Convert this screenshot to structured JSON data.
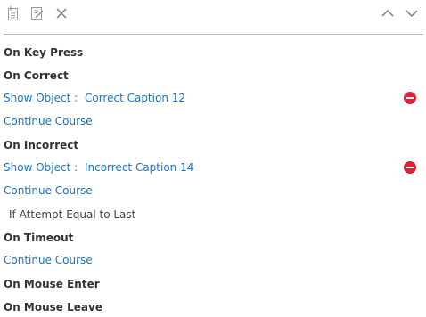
{
  "toolbar": {
    "icons": [
      "new-action-icon",
      "edit-action-icon",
      "close-icon",
      "chevron-up-icon",
      "chevron-down-icon"
    ]
  },
  "events": {
    "on_key_press": "On Key Press",
    "on_correct": "On Correct",
    "correct_show_label": "Show Object :",
    "correct_show_target": "Correct Caption 12",
    "correct_continue": "Continue Course",
    "on_incorrect": "On Incorrect",
    "incorrect_show_label": "Show Object :",
    "incorrect_show_target": "Incorrect Caption 14",
    "incorrect_continue": "Continue Course",
    "incorrect_condition": "If Attempt Equal to Last",
    "on_timeout": "On Timeout",
    "timeout_continue": "Continue Course",
    "on_mouse_enter": "On Mouse Enter",
    "on_mouse_leave": "On Mouse Leave"
  },
  "colors": {
    "link": "#1a73c8",
    "remove": "#e0203a",
    "icon": "#9e9e9e"
  }
}
